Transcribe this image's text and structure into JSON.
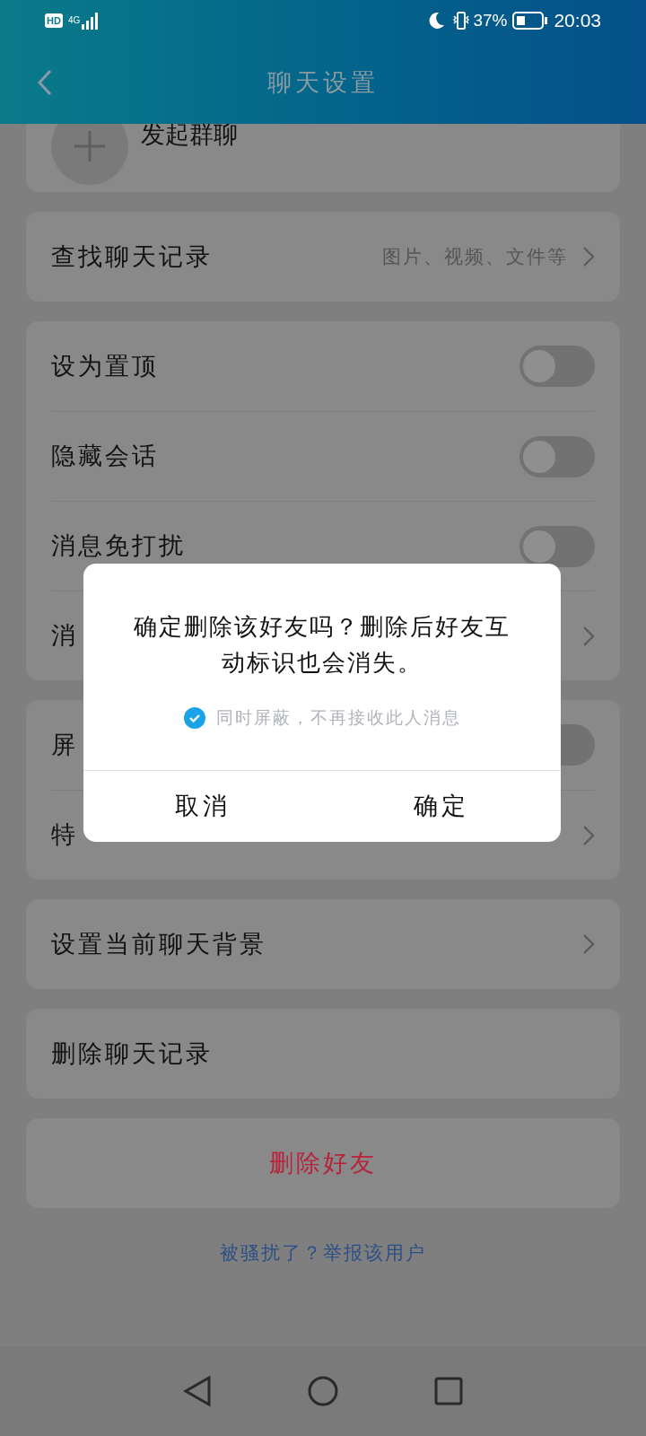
{
  "status_bar": {
    "hd": "HD",
    "network": "4G",
    "battery": "37%",
    "time": "20:03"
  },
  "header": {
    "title": "聊天设置"
  },
  "group_chat": {
    "label": "发起群聊"
  },
  "groups": [
    {
      "items": [
        {
          "kind": "link",
          "label": "查找聊天记录",
          "value": "图片、视频、文件等"
        }
      ]
    },
    {
      "items": [
        {
          "kind": "toggle",
          "label": "设为置顶",
          "on": false
        },
        {
          "kind": "toggle",
          "label": "隐藏会话",
          "on": false
        },
        {
          "kind": "toggle",
          "label": "消息免打扰",
          "on": false
        },
        {
          "kind": "link",
          "label": "消"
        }
      ]
    },
    {
      "items": [
        {
          "kind": "toggle",
          "label": "屏",
          "on": false
        },
        {
          "kind": "link",
          "label": "特"
        }
      ]
    },
    {
      "items": [
        {
          "kind": "link",
          "label": "设置当前聊天背景"
        }
      ]
    },
    {
      "items": [
        {
          "kind": "plain",
          "label": "删除聊天记录"
        }
      ]
    },
    {
      "items": [
        {
          "kind": "danger",
          "label": "删除好友"
        }
      ]
    }
  ],
  "report_link": "被骚扰了？举报该用户",
  "dialog": {
    "message": "确定删除该好友吗？删除后好友互动标识也会消失。",
    "option": {
      "label": "同时屏蔽，不再接收此人消息",
      "checked": true
    },
    "buttons": [
      "取消",
      "确定"
    ]
  }
}
